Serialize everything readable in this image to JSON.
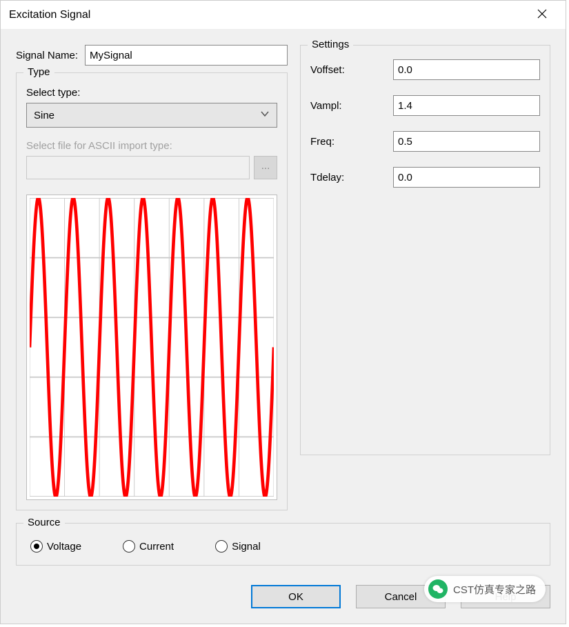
{
  "window": {
    "title": "Excitation Signal"
  },
  "signal_name": {
    "label": "Signal Name:",
    "value": "MySignal"
  },
  "type_group": {
    "title": "Type",
    "select_label": "Select type:",
    "select_value": "Sine",
    "ascii_label": "Select file for ASCII import type:",
    "ascii_value": "",
    "browse_label": "..."
  },
  "settings_group": {
    "title": "Settings",
    "fields": {
      "voffset": {
        "label": "Voffset:",
        "value": "0.0"
      },
      "vampl": {
        "label": "Vampl:",
        "value": "1.4"
      },
      "freq": {
        "label": "Freq:",
        "value": "0.5"
      },
      "tdelay": {
        "label": "Tdelay:",
        "value": "0.0"
      }
    }
  },
  "source_group": {
    "title": "Source",
    "options": {
      "voltage": "Voltage",
      "current": "Current",
      "signal": "Signal"
    },
    "selected": "voltage"
  },
  "buttons": {
    "ok": "OK",
    "cancel": "Cancel",
    "help": "Help"
  },
  "watermark": {
    "text": "CST仿真专家之路"
  },
  "chart_data": {
    "type": "line",
    "title": "",
    "xlabel": "",
    "ylabel": "",
    "xlim": [
      0,
      14
    ],
    "ylim": [
      -1.4,
      1.4
    ],
    "function": "sine",
    "amplitude": 1.4,
    "frequency": 0.5,
    "offset": 0.0,
    "tdelay": 0.0,
    "cycles_shown": 7,
    "grid": true,
    "color": "#ff0000",
    "line_width": 5
  }
}
